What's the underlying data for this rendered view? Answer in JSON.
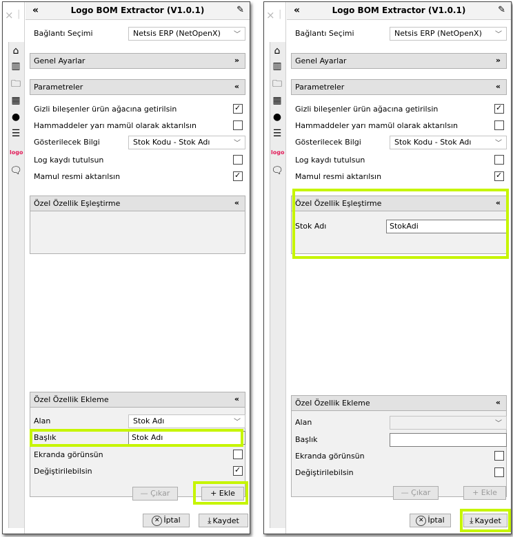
{
  "left": {
    "title": "Logo BOM Extractor (V1.0.1)",
    "icons": {
      "close": "×",
      "collapse": "«",
      "pin": "📌"
    },
    "connection": {
      "label": "Bağlantı Seçimi",
      "value": "Netsis ERP (NetOpenX)"
    },
    "general_section": {
      "label": "Genel Ayarlar",
      "toggle": "»"
    },
    "params_section": {
      "label": "Parametreler",
      "toggle": "«"
    },
    "params": {
      "hidden_components": {
        "label": "Gizli bileşenler ürün ağacına getirilsin",
        "checked": true
      },
      "raw_semi": {
        "label": "Hammaddeler yarı mamül olarak aktarılsın",
        "checked": false
      },
      "display_info": {
        "label": "Gösterilecek Bilgi",
        "value": "Stok Kodu - Stok Adı"
      },
      "log": {
        "label": "Log kaydı tutulsun",
        "checked": false
      },
      "product_image": {
        "label": "Mamul resmi aktarılsın",
        "checked": true
      }
    },
    "mapping_section": {
      "label": "Özel Özellik Eşleştirme",
      "toggle": "«"
    },
    "add_section": {
      "label": "Özel Özellik Ekleme",
      "toggle": "«"
    },
    "add": {
      "field": {
        "label": "Alan",
        "value": "Stok Adı"
      },
      "caption": {
        "label": "Başlık",
        "value": "Stok Adı"
      },
      "visible": {
        "label": "Ekranda görünsün",
        "checked": false
      },
      "editable": {
        "label": "Değiştirilebilsin",
        "checked": true
      }
    },
    "remove_button": "— Çıkar",
    "add_button": "+ Ekle",
    "cancel_button": "İptal",
    "save_button": "Kaydet"
  },
  "right": {
    "title": "Logo BOM Extractor (V1.0.1)",
    "connection": {
      "label": "Bağlantı Seçimi",
      "value": "Netsis ERP (NetOpenX)"
    },
    "general_section": {
      "label": "Genel Ayarlar",
      "toggle": "»"
    },
    "params_section": {
      "label": "Parametreler",
      "toggle": "«"
    },
    "params": {
      "hidden_components": {
        "label": "Gizli bileşenler ürün ağacına getirilsin",
        "checked": true
      },
      "raw_semi": {
        "label": "Hammaddeler yarı mamül olarak aktarılsın",
        "checked": false
      },
      "display_info": {
        "label": "Gösterilecek Bilgi",
        "value": "Stok Kodu - Stok Adı"
      },
      "log": {
        "label": "Log kaydı tutulsun",
        "checked": false
      },
      "product_image": {
        "label": "Mamul resmi aktarılsın",
        "checked": true
      }
    },
    "mapping_section": {
      "label": "Özel Özellik Eşleştirme",
      "toggle": "«"
    },
    "mapping_row": {
      "label": "Stok Adı",
      "value": "StokAdi"
    },
    "add_section": {
      "label": "Özel Özellik Ekleme",
      "toggle": "«"
    },
    "add": {
      "field": {
        "label": "Alan",
        "value": ""
      },
      "caption": {
        "label": "Başlık",
        "value": ""
      },
      "visible": {
        "label": "Ekranda görünsün",
        "checked": false
      },
      "editable": {
        "label": "Değiştirilebilsin",
        "checked": false
      }
    },
    "remove_button": "— Çıkar",
    "add_button": "+ Ekle",
    "cancel_button": "İptal",
    "save_button": "Kaydet"
  },
  "highlight_color": "#c6f500"
}
